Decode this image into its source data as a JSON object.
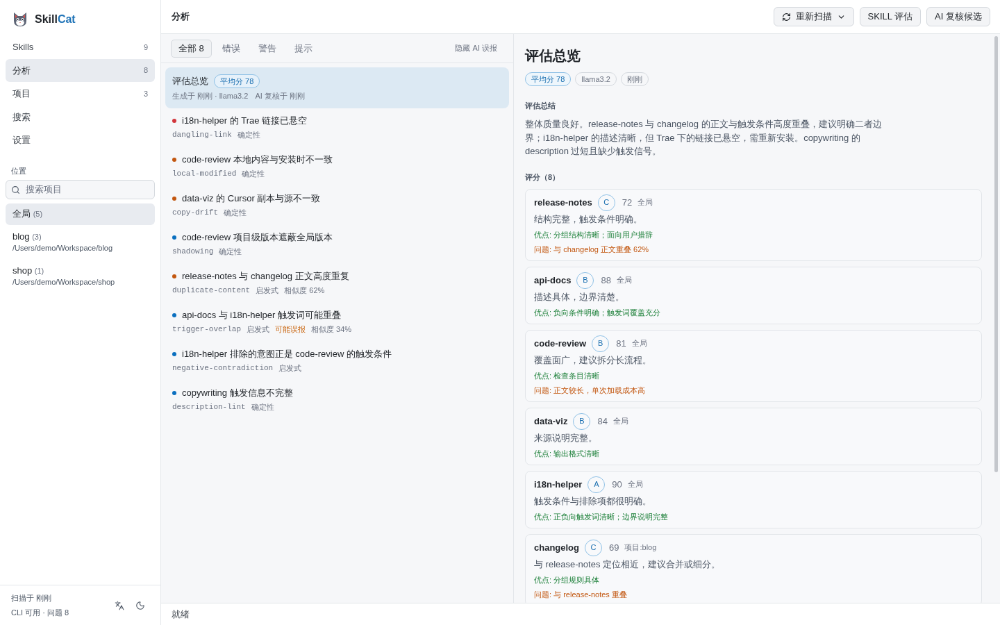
{
  "logo": {
    "text": "Skill",
    "accent": "Cat"
  },
  "sidebar": {
    "nav": [
      {
        "label": "Skills",
        "count": "9",
        "selected": false
      },
      {
        "label": "分析",
        "count": "8",
        "selected": true
      },
      {
        "label": "项目",
        "count": "3",
        "selected": false
      },
      {
        "label": "搜索",
        "selected": false
      },
      {
        "label": "设置",
        "selected": false
      }
    ],
    "locations_label": "位置",
    "search": {
      "placeholder": "搜索项目"
    },
    "locations": [
      {
        "label": "全局",
        "count": "(5)",
        "selected": true
      },
      {
        "label": "blog",
        "count": "(3)",
        "path": "/Users/demo/Workspace/blog",
        "selected": false
      },
      {
        "label": "shop",
        "count": "(1)",
        "path": "/Users/demo/Workspace/shop",
        "selected": false
      }
    ],
    "footer": {
      "scan_status": "扫描于 刚刚",
      "cli_status": "CLI 可用 · 问题 8"
    }
  },
  "header": {
    "title": "分析",
    "buttons": [
      {
        "kind": "rescan",
        "label": "重新扫描"
      },
      {
        "kind": "plain",
        "label": "SKILL 评估"
      },
      {
        "kind": "plain",
        "label": "AI 复核候选"
      }
    ]
  },
  "filters": {
    "tabs": [
      {
        "label": "全部",
        "count": "8",
        "selected": true
      },
      {
        "label": "错误",
        "selected": false
      },
      {
        "label": "警告",
        "selected": false
      },
      {
        "label": "提示",
        "selected": false
      }
    ],
    "hide_false_positives": "隐藏 AI 误报"
  },
  "overview_item": {
    "title": "评估总览",
    "badge": "平均分 78",
    "meta": "生成于 刚刚 · llama3.2",
    "review": "AI 复核于 刚刚",
    "selected": true
  },
  "issues": [
    {
      "color": "#d2363c",
      "title": "i18n-helper 的 Trae 链接已悬空",
      "rule": "dangling-link",
      "tags": [
        {
          "kind": "plain",
          "text": "确定性"
        }
      ],
      "selected": false
    },
    {
      "color": "#c2560f",
      "title": "code-review 本地内容与安装时不一致",
      "rule": "local-modified",
      "tags": [
        {
          "kind": "plain",
          "text": "确定性"
        }
      ],
      "selected": false
    },
    {
      "color": "#c2560f",
      "title": "data-viz 的 Cursor 副本与源不一致",
      "rule": "copy-drift",
      "tags": [
        {
          "kind": "plain",
          "text": "确定性"
        }
      ],
      "selected": false
    },
    {
      "color": "#0a6fbf",
      "title": "code-review 项目级版本遮蔽全局版本",
      "rule": "shadowing",
      "tags": [
        {
          "kind": "plain",
          "text": "确定性"
        }
      ],
      "selected": false
    },
    {
      "color": "#c2560f",
      "title": "release-notes 与 changelog 正文高度重复",
      "rule": "duplicate-content",
      "tags": [
        {
          "kind": "plain",
          "text": "启发式"
        },
        {
          "kind": "plain",
          "text": "相似度 62%"
        }
      ],
      "selected": false
    },
    {
      "color": "#0a6fbf",
      "title": "api-docs 与 i18n-helper 触发词可能重叠",
      "rule": "trigger-overlap",
      "tags": [
        {
          "kind": "plain",
          "text": "启发式"
        },
        {
          "kind": "warning",
          "text": "可能误报"
        },
        {
          "kind": "plain",
          "text": "相似度 34%"
        }
      ],
      "selected": false
    },
    {
      "color": "#0a6fbf",
      "title": "i18n-helper 排除的意图正是 code-review 的触发条件",
      "rule": "negative-contradiction",
      "tags": [
        {
          "kind": "plain",
          "text": "启发式"
        }
      ],
      "selected": false
    },
    {
      "color": "#0a6fbf",
      "title": "copywriting 触发信息不完整",
      "rule": "description-lint",
      "tags": [
        {
          "kind": "plain",
          "text": "确定性"
        }
      ],
      "selected": false
    }
  ],
  "detail": {
    "title": "评估总览",
    "badges": [
      {
        "kind": "accent",
        "text": "平均分 78"
      },
      {
        "kind": "plain",
        "text": "llama3.2"
      },
      {
        "kind": "plain",
        "text": "刚刚"
      }
    ],
    "summary_label": "评估总结",
    "summary": "整体质量良好。release-notes 与 changelog 的正文与触发条件高度重叠，建议明确二者边界；i18n-helper 的描述清晰，但 Trae 下的链接已悬空，需重新安装。copywriting 的 description 过短且缺少触发信号。",
    "scores_label": "评分（8）",
    "scores": [
      {
        "name": "release-notes",
        "grade": "C",
        "score": "72",
        "scope": "全局",
        "comment": "结构完整，触发条件明确。",
        "pros": "优点: 分组结构清晰；面向用户措辞",
        "problems": "问题: 与 changelog 正文重叠 62%"
      },
      {
        "name": "api-docs",
        "grade": "B",
        "score": "88",
        "scope": "全局",
        "comment": "描述具体，边界清楚。",
        "pros": "优点: 负向条件明确；触发词覆盖充分"
      },
      {
        "name": "code-review",
        "grade": "B",
        "score": "81",
        "scope": "全局",
        "comment": "覆盖面广，建议拆分长流程。",
        "pros": "优点: 检查条目清晰",
        "problems": "问题: 正文较长，单次加载成本高"
      },
      {
        "name": "data-viz",
        "grade": "B",
        "score": "84",
        "scope": "全局",
        "comment": "来源说明完整。",
        "pros": "优点: 输出格式清晰"
      },
      {
        "name": "i18n-helper",
        "grade": "A",
        "score": "90",
        "scope": "全局",
        "comment": "触发条件与排除项都很明确。",
        "pros": "优点: 正负向触发词清晰；边界说明完整"
      },
      {
        "name": "changelog",
        "grade": "C",
        "score": "69",
        "scope": "项目:blog",
        "comment": "与 release-notes 定位相近，建议合并或细分。",
        "pros": "优点: 分组规则具体",
        "problems": "问题: 与 release-notes 重叠"
      }
    ]
  },
  "status_bar": {
    "text": "就绪"
  }
}
